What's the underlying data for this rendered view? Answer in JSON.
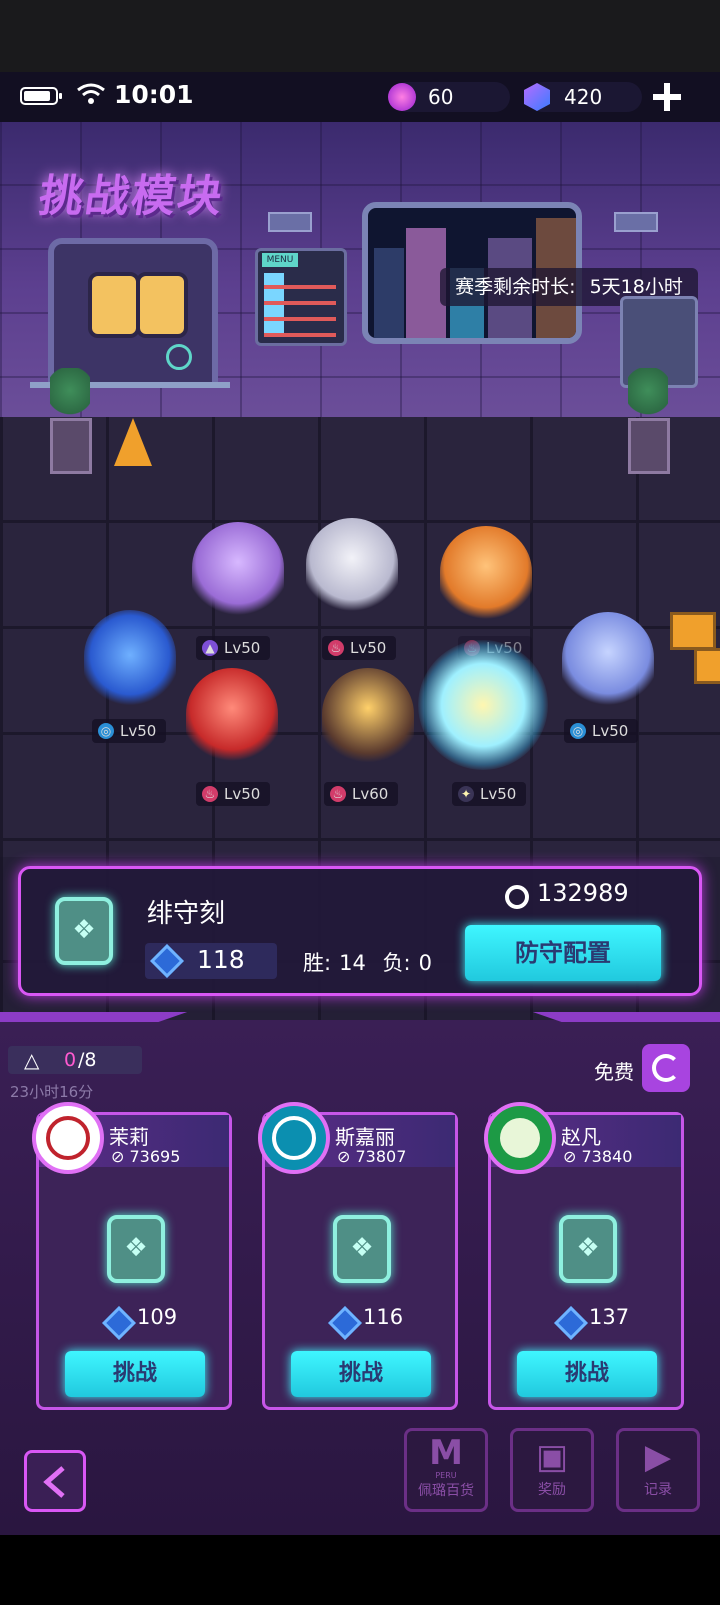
{
  "status_bar": {
    "time": "10:01",
    "energy": "60",
    "crystals": "420",
    "add_icon": "plus-icon"
  },
  "scene": {
    "title": "挑战模块",
    "season_label": "赛季剩余时长:",
    "season_remaining": "5天18小时",
    "menu_sign": "MENU"
  },
  "characters": [
    {
      "level": "Lv50",
      "element": "shadow"
    },
    {
      "level": "Lv50",
      "element": "fire"
    },
    {
      "level": "Lv50",
      "element": "fire"
    },
    {
      "level": "Lv50",
      "element": "water"
    },
    {
      "level": "Lv50",
      "element": "fire"
    },
    {
      "level": "Lv60",
      "element": "fire"
    },
    {
      "level": "Lv50",
      "element": "light"
    },
    {
      "level": "Lv50",
      "element": "water"
    }
  ],
  "player": {
    "name": "绯守刻",
    "power": "132989",
    "defense_score": "118",
    "win_label": "胜:",
    "wins": "14",
    "loss_label": "负:",
    "losses": "0",
    "defense_button": "防守配置"
  },
  "challenge": {
    "attempts": "0",
    "attempts_total": "/8",
    "refresh_timer": "23小时16分",
    "free_label": "免费",
    "opponents": [
      {
        "name": "茉莉",
        "power": "73695",
        "defense_score": "109",
        "button": "挑战",
        "avatar_color": "#c0232d"
      },
      {
        "name": "斯嘉丽",
        "power": "73807",
        "defense_score": "116",
        "button": "挑战",
        "avatar_color": "#0b8fb0"
      },
      {
        "name": "赵凡",
        "power": "73840",
        "defense_score": "137",
        "button": "挑战",
        "avatar_color": "#1d9a45"
      }
    ]
  },
  "nav": {
    "back_icon": "chevron-left-icon",
    "shop_logo": "PERU",
    "shop_label": "佩璐百货",
    "reward_label": "奖励",
    "record_label": "记录"
  },
  "colors": {
    "accent": "#d957f5",
    "cyan": "#3ff6ff",
    "panel": "#22183a"
  }
}
